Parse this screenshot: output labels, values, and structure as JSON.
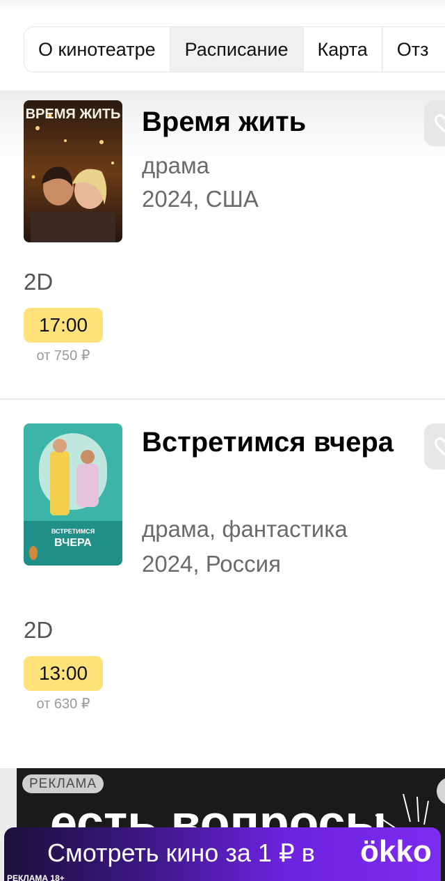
{
  "tabs": [
    {
      "label": "О кинотеатре",
      "active": false
    },
    {
      "label": "Расписание",
      "active": true
    },
    {
      "label": "Карта",
      "active": false
    },
    {
      "label": "Отз",
      "active": false
    }
  ],
  "movies": [
    {
      "title": "Время жить",
      "genre": "драма",
      "meta": "2024, США",
      "poster_icon": "poster-vremya-zhit",
      "poster_title": "ВРЕМЯ ЖИТЬ",
      "sessions": [
        {
          "format": "2D",
          "time": "17:00",
          "price": "от 750 ₽"
        }
      ]
    },
    {
      "title": "Встретимся вчера",
      "genre": "драма, фантастика",
      "meta": "2024, Россия",
      "poster_icon": "poster-vstretimsya-vchera",
      "poster_title": "ВСТРЕТИМСЯ ВЧЕРА",
      "sessions": [
        {
          "format": "2D",
          "time": "13:00",
          "price": "от 630 ₽"
        }
      ]
    }
  ],
  "ad": {
    "label": "РЕКЛАМА",
    "big_text": "есть вопросы",
    "banner_text": "Смотреть кино за 1 ₽ в",
    "banner_logo": "ökko",
    "age_label": "РЕКЛАМА 18+"
  },
  "colors": {
    "session_bg": "#ffe27a",
    "tab_active_bg": "#f0f0f0",
    "banner_gradient_start": "#1c0f3b",
    "banner_gradient_end": "#7d2cf0"
  }
}
